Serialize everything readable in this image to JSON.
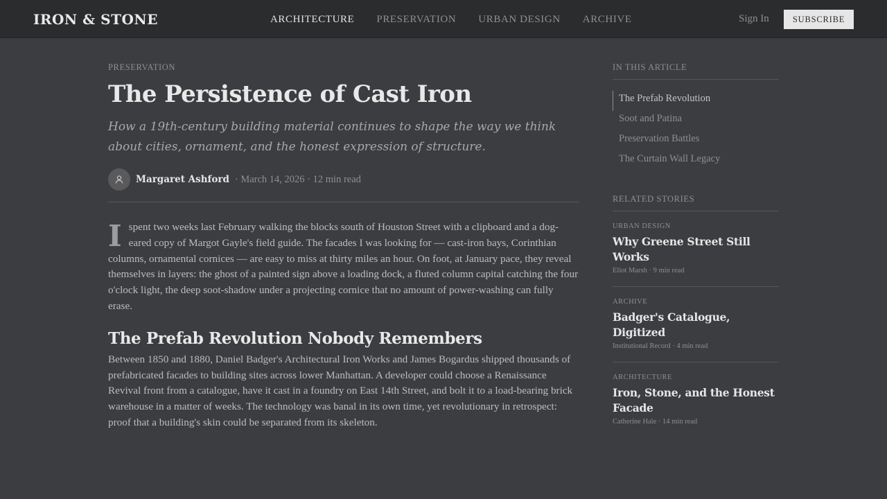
{
  "header": {
    "brand": "IRON & STONE",
    "nav": [
      {
        "label": "ARCHITECTURE",
        "active": true
      },
      {
        "label": "PRESERVATION",
        "active": false
      },
      {
        "label": "URBAN DESIGN",
        "active": false
      },
      {
        "label": "ARCHIVE",
        "active": false
      }
    ],
    "signin_label": "Sign In",
    "subscribe_label": "SUBSCRIBE"
  },
  "article": {
    "kicker": "PRESERVATION",
    "title": "The Persistence of Cast Iron",
    "dek": "How a 19th-century building material continues to shape the way we think about cities, ornament, and the honest expression of structure.",
    "author": "Margaret Ashford",
    "meta": "· March 14, 2026 · 12 min read",
    "dropcap": "I",
    "para1": "spent two weeks last February walking the blocks south of Houston Street with a clipboard and a dog-eared copy of Margot Gayle's field guide. The facades I was looking for — cast-iron bays, Corinthian columns, ornamental cornices — are easy to miss at thirty miles an hour. On foot, at January pace, they reveal themselves in layers: the ghost of a painted sign above a loading dock, a fluted column capital catching the four o'clock light, the deep soot-shadow under a projecting cornice that no amount of power-washing can fully erase.",
    "h2": "The Prefab Revolution Nobody Remembers",
    "para2": "Between 1850 and 1880, Daniel Badger's Architectural Iron Works and James Bogardus shipped thousands of prefabricated facades to building sites across lower Manhattan. A developer could choose a Renaissance Revival front from a catalogue, have it cast in a foundry on East 14th Street, and bolt it to a load-bearing brick warehouse in a matter of weeks. The technology was banal in its own time, yet revolutionary in retrospect: proof that a building's skin could be separated from its skeleton."
  },
  "sidebar": {
    "toc_heading": "IN THIS ARTICLE",
    "toc": [
      {
        "label": "The Prefab Revolution",
        "active": true
      },
      {
        "label": "Soot and Patina",
        "active": false
      },
      {
        "label": "Preservation Battles",
        "active": false
      },
      {
        "label": "The Curtain Wall Legacy",
        "active": false
      }
    ],
    "related_heading": "RELATED STORIES",
    "related": [
      {
        "category": "URBAN DESIGN",
        "title": "Why Greene Street Still Works",
        "meta": "Eliot Marsh · 9 min read"
      },
      {
        "category": "ARCHIVE",
        "title": "Badger's Catalogue, Digitized",
        "meta": "Institutional Record · 4 min read"
      },
      {
        "category": "ARCHITECTURE",
        "title": "Iron, Stone, and the Honest Facade",
        "meta": "Catherine Hale · 14 min read"
      }
    ]
  },
  "icons": {
    "avatar": "user-icon"
  }
}
